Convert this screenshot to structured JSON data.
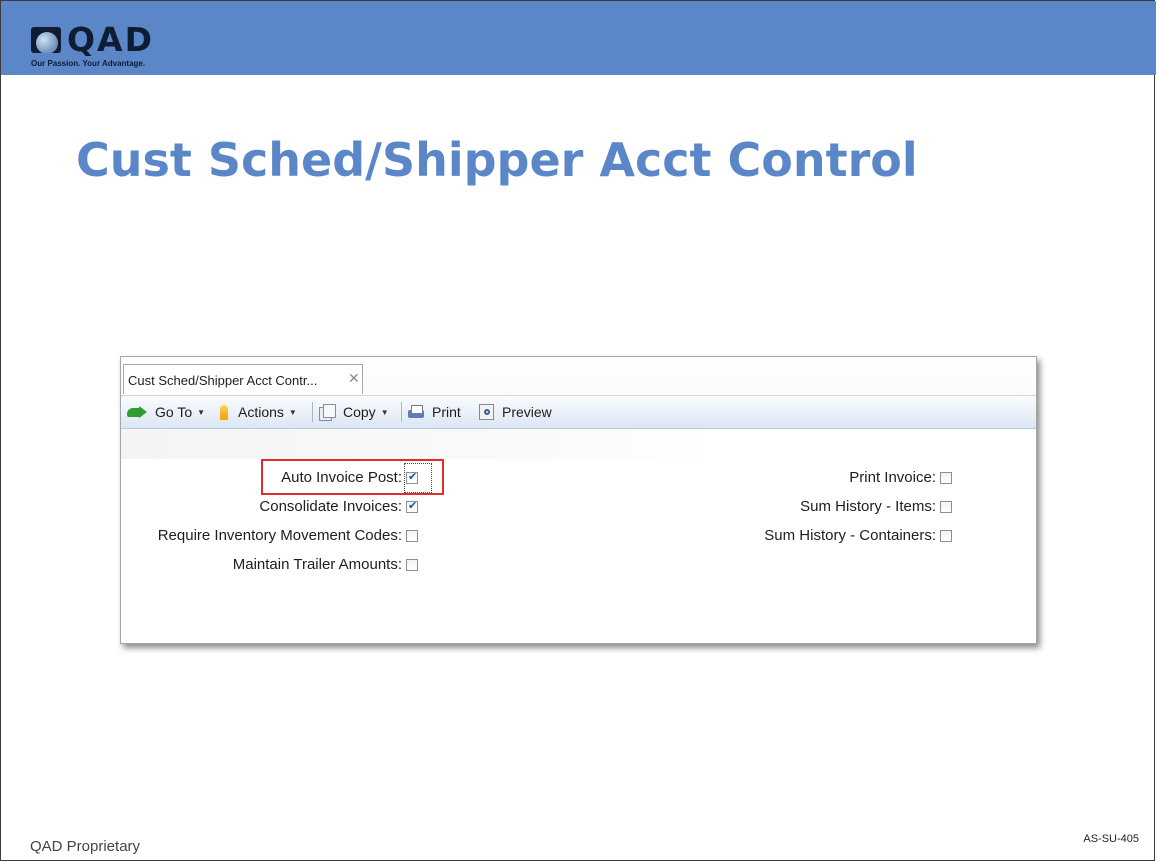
{
  "brand": {
    "name": "QAD",
    "tagline": "Our Passion. Your Advantage."
  },
  "slide": {
    "title": "Cust Sched/Shipper Acct Control",
    "footer_left": "QAD Proprietary",
    "footer_right": "AS-SU-405"
  },
  "app": {
    "tab": {
      "label": "Cust Sched/Shipper Acct Contr...",
      "close_glyph": "✕"
    },
    "toolbar": {
      "goto": "Go To",
      "actions": "Actions",
      "copy": "Copy",
      "print": "Print",
      "preview": "Preview",
      "dropdown_glyph": "▼"
    },
    "fields_left": [
      {
        "label": "Auto Invoice Post:",
        "checked": true
      },
      {
        "label": "Consolidate Invoices:",
        "checked": true
      },
      {
        "label": "Require Inventory Movement Codes:",
        "checked": false
      },
      {
        "label": "Maintain Trailer Amounts:",
        "checked": false
      }
    ],
    "fields_right": [
      {
        "label": "Print Invoice:",
        "checked": false
      },
      {
        "label": "Sum History - Items:",
        "checked": false
      },
      {
        "label": "Sum History - Containers:",
        "checked": false
      }
    ]
  },
  "colors": {
    "header_band": "#5b87c8",
    "title": "#5b87c8",
    "highlight": "#e42c2c"
  },
  "icons": [
    "goto-arrow-icon",
    "actions-icon",
    "copy-icon",
    "print-icon",
    "preview-icon",
    "tab-close-icon",
    "qad-logo-icon"
  ]
}
